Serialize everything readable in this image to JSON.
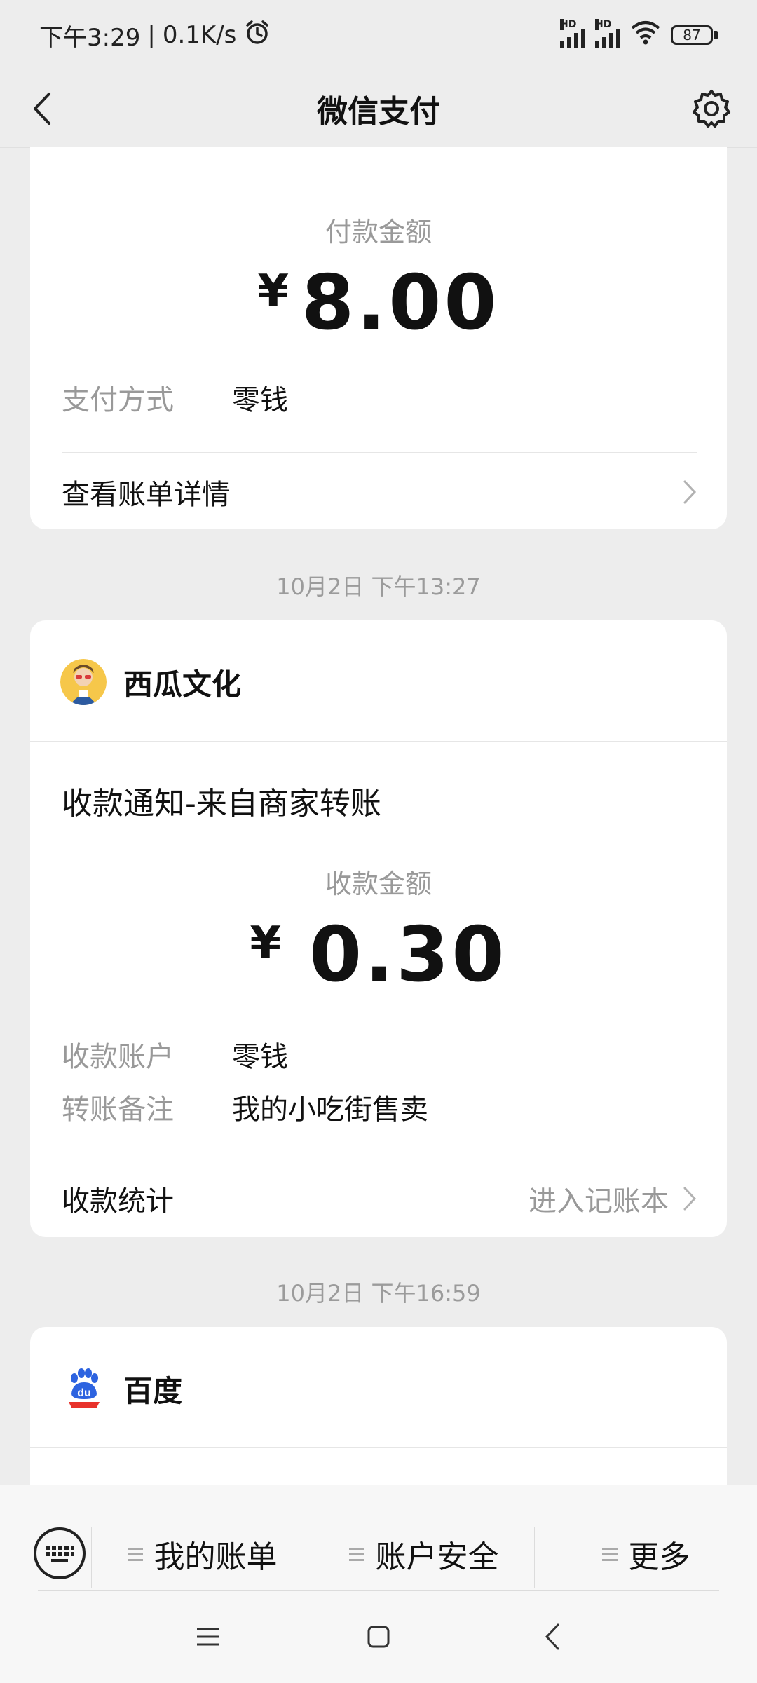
{
  "status_bar": {
    "time": "下午3:29",
    "separator": "|",
    "net_speed": "0.1K/s",
    "battery": "87",
    "alarm_icon": "alarm-icon",
    "signal_label": "HD"
  },
  "nav": {
    "title": "微信支付",
    "back_icon": "back-chevron-icon",
    "settings_icon": "gear-icon"
  },
  "card1": {
    "amount_label": "付款金额",
    "currency": "¥",
    "amount": "8.00",
    "method_label": "支付方式",
    "method_value": "零钱",
    "details_link": "查看账单详情"
  },
  "timestamp1": "10月2日 下午13:27",
  "card2": {
    "merchant_name": "西瓜文化",
    "notice_title": "收款通知-来自商家转账",
    "amount_label": "收款金额",
    "currency": "¥",
    "amount": "0.30",
    "account_label": "收款账户",
    "account_value": "零钱",
    "remark_label": "转账备注",
    "remark_value": "我的小吃街售卖",
    "stats_label": "收款统计",
    "stats_link": "进入记账本"
  },
  "timestamp2": "10月2日 下午16:59",
  "card3": {
    "merchant_name": "百度",
    "logo_text": "du"
  },
  "bottom_menu": {
    "items": [
      {
        "label": "我的账单"
      },
      {
        "label": "账户安全"
      },
      {
        "label": "更多"
      }
    ]
  },
  "colors": {
    "background": "#ededed",
    "card": "#ffffff",
    "muted_text": "#999999",
    "baidu_blue": "#2d63e0",
    "baidu_red": "#e8322b"
  }
}
